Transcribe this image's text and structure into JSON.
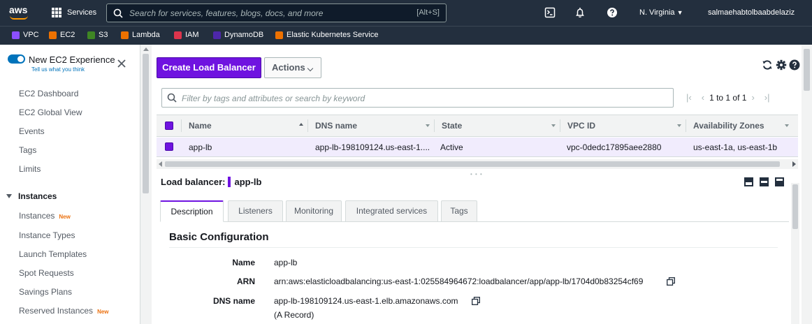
{
  "topnav": {
    "logo_text": "aws",
    "services_label": "Services",
    "search_placeholder": "Search for services, features, blogs, docs, and more",
    "search_shortcut": "[Alt+S]",
    "region": "N. Virginia",
    "account": "salmaehabtolbaabdelaziz"
  },
  "favorites": [
    {
      "label": "VPC",
      "color": "#8c4fff"
    },
    {
      "label": "EC2",
      "color": "#ed7100"
    },
    {
      "label": "S3",
      "color": "#3f8624"
    },
    {
      "label": "Lambda",
      "color": "#ed7100"
    },
    {
      "label": "IAM",
      "color": "#dd344c"
    },
    {
      "label": "DynamoDB",
      "color": "#4d27aa"
    },
    {
      "label": "Elastic Kubernetes Service",
      "color": "#ed7100"
    }
  ],
  "sidebar": {
    "toggle_label": "New EC2 Experience",
    "tell_us": "Tell us what you think",
    "items": [
      "EC2 Dashboard",
      "EC2 Global View",
      "Events",
      "Tags",
      "Limits"
    ],
    "section": "Instances",
    "section_items": [
      "Instances",
      "Instance Types",
      "Launch Templates",
      "Spot Requests",
      "Savings Plans",
      "Reserved Instances"
    ],
    "new_badge": "New"
  },
  "toolbar": {
    "create_label": "Create Load Balancer",
    "actions_label": "Actions"
  },
  "filter": {
    "placeholder": "Filter by tags and attributes or search by keyword",
    "page_info": "1 to 1 of 1"
  },
  "table": {
    "columns": [
      "Name",
      "DNS name",
      "State",
      "VPC ID",
      "Availability Zones"
    ],
    "rows": [
      {
        "name": "app-lb",
        "dns": "app-lb-198109124.us-east-1....",
        "state": "Active",
        "vpc": "vpc-0dedc17895aee2880",
        "az": "us-east-1a, us-east-1b"
      }
    ]
  },
  "detail": {
    "label": "Load balancer:",
    "value": "app-lb",
    "tabs": [
      "Description",
      "Listeners",
      "Monitoring",
      "Integrated services",
      "Tags"
    ],
    "section_title": "Basic Configuration",
    "fields": [
      {
        "key": "Name",
        "value": "app-lb"
      },
      {
        "key": "ARN",
        "value": "arn:aws:elasticloadbalancing:us-east-1:025584964672:loadbalancer/app/app-lb/1704d0b83254cf69"
      },
      {
        "key": "DNS name",
        "value": "app-lb-198109124.us-east-1.elb.amazonaws.com",
        "extra": "(A Record)"
      }
    ]
  },
  "colors": {
    "nav_bg": "#232f3e",
    "primary": "#6f13e0",
    "selected_row": "#f1ecfd",
    "link": "#0073bb",
    "new_badge": "#ec7211"
  }
}
